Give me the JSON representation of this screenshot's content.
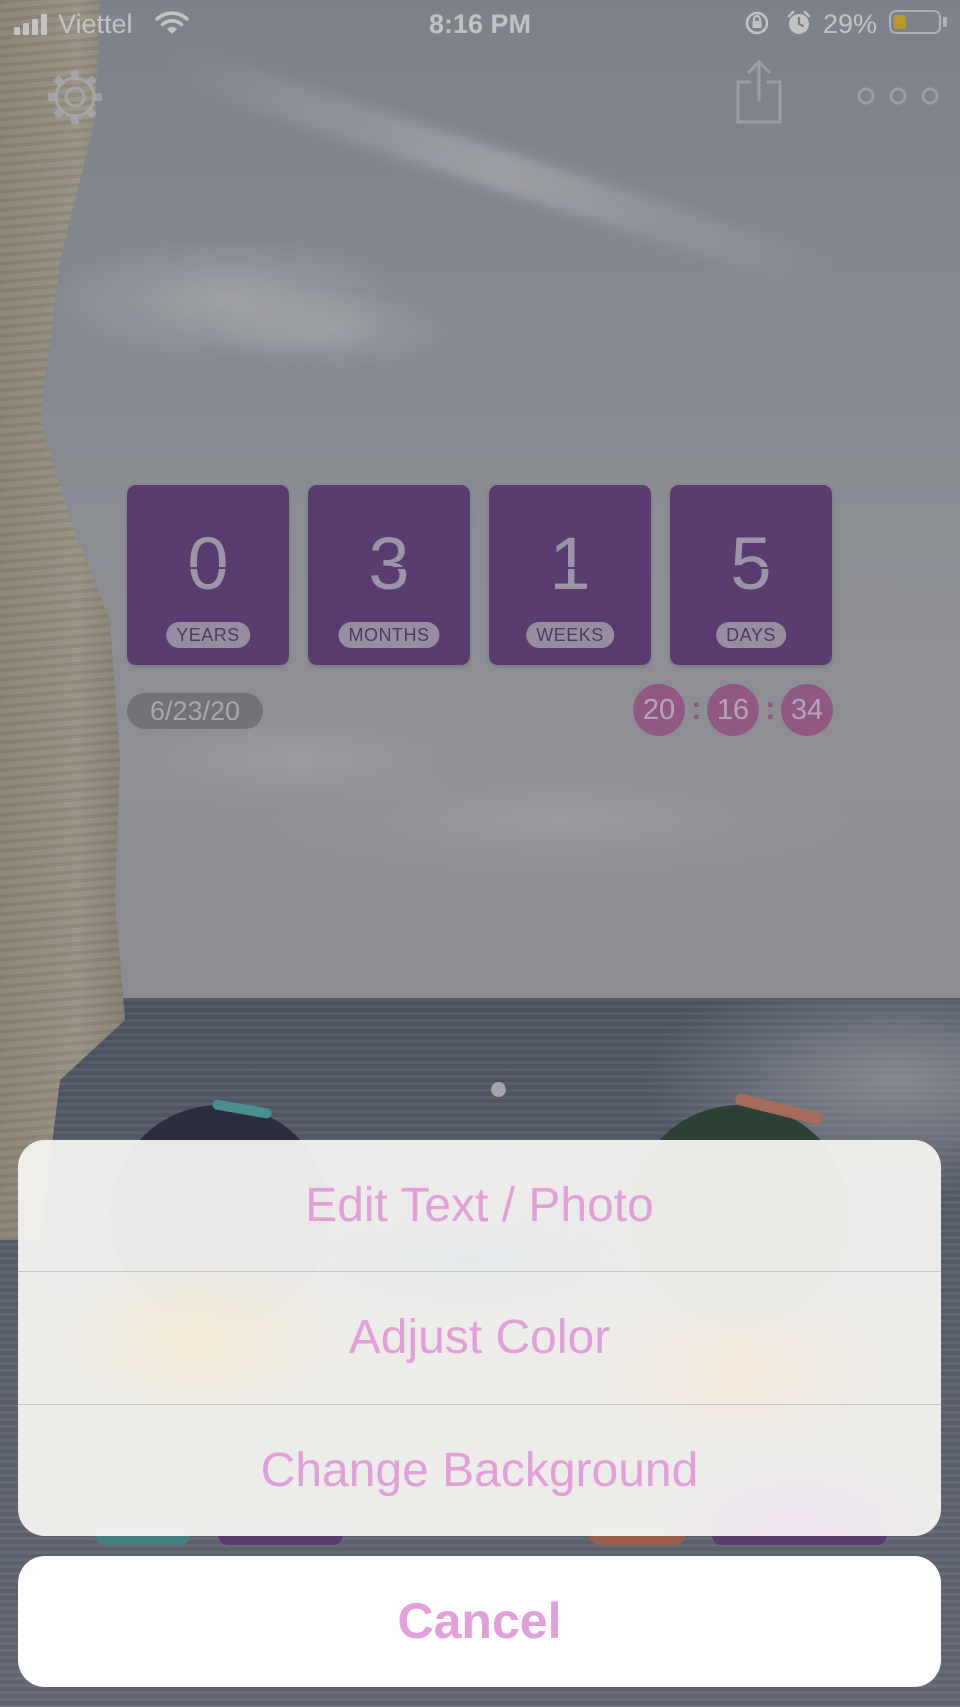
{
  "status_bar": {
    "carrier": "Viettel",
    "time": "8:16 PM",
    "battery_percent": "29%",
    "battery_level": 0.29,
    "signal_bars": 4
  },
  "toolbar": {
    "settings_icon": "gear-icon",
    "share_icon": "share-icon",
    "more_icon": "more-dots-icon"
  },
  "countdown": {
    "tiles": [
      {
        "value": "0",
        "label": "YEARS"
      },
      {
        "value": "3",
        "label": "MONTHS"
      },
      {
        "value": "1",
        "label": "WEEKS"
      },
      {
        "value": "5",
        "label": "DAYS"
      }
    ],
    "date": "6/23/20",
    "time": {
      "hours": "20",
      "minutes": "16",
      "seconds": "34",
      "separator": ":"
    },
    "tile_color": "#6c4388",
    "time_bubble_color": "#b86ba4"
  },
  "action_sheet": {
    "items": [
      {
        "label": "Edit Text / Photo"
      },
      {
        "label": "Adjust Color"
      },
      {
        "label": "Change Background"
      }
    ],
    "cancel_label": "Cancel",
    "tint_color": "#e29fd9"
  }
}
